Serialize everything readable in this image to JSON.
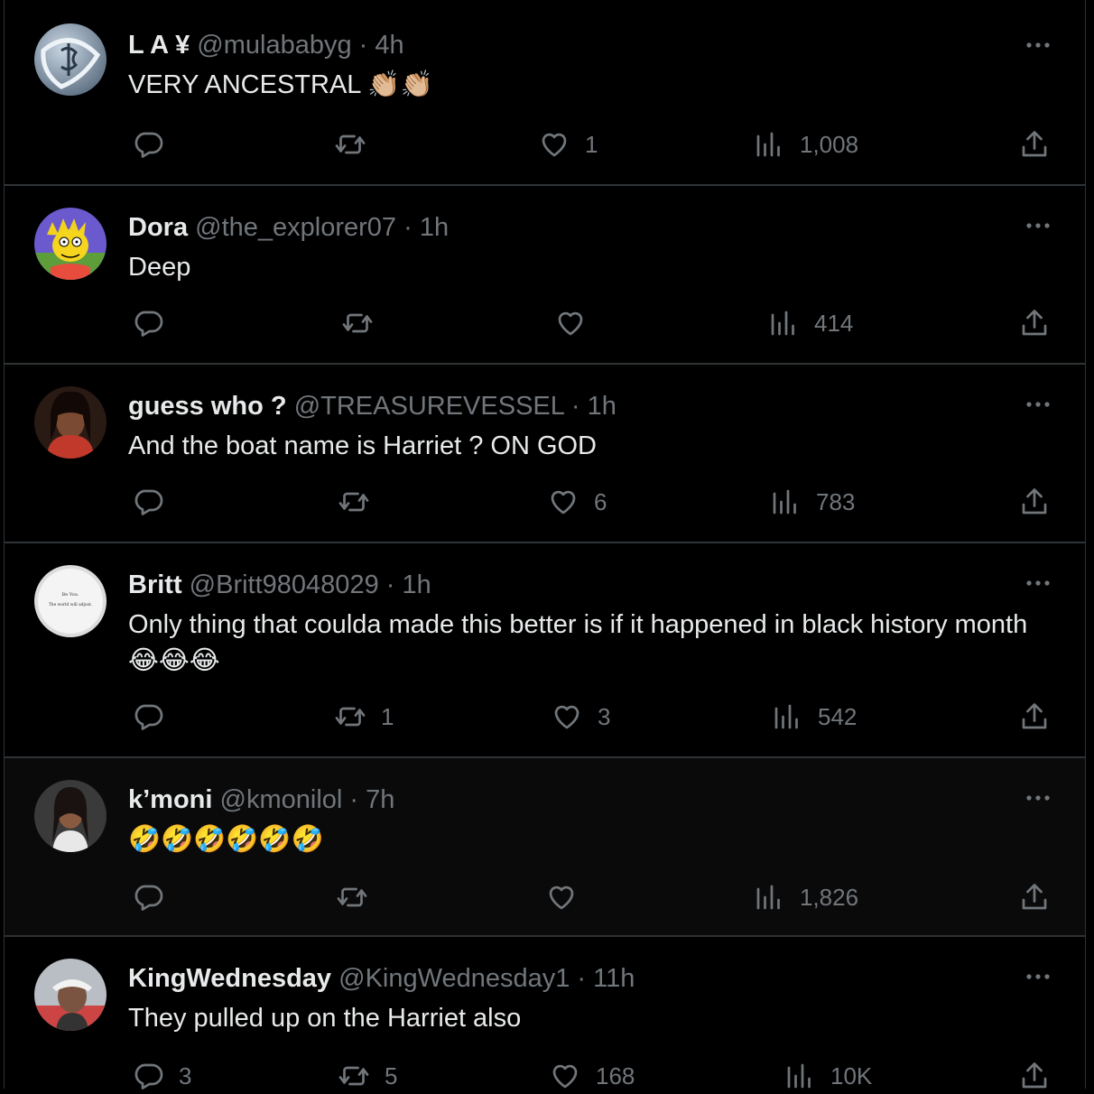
{
  "colors": {
    "background": "#000000",
    "text": "#e7e9ea",
    "secondary": "#71767b",
    "divider": "#2f3336"
  },
  "icons": {
    "reply": "reply-icon",
    "retweet": "retweet-icon",
    "like": "heart-icon",
    "views": "views-icon",
    "share": "share-icon",
    "more": "more-icon"
  },
  "tweets": [
    {
      "name": "L A ¥",
      "handle": "@mulababyg",
      "sep": "·",
      "time": "4h",
      "text": "VERY ANCESTRAL 👏🏼👏🏼",
      "replies": "",
      "retweets": "",
      "likes": "1",
      "views": "1,008"
    },
    {
      "name": "Dora",
      "handle": "@the_explorer07",
      "sep": "·",
      "time": "1h",
      "text": "Deep",
      "replies": "",
      "retweets": "",
      "likes": "",
      "views": "414"
    },
    {
      "name": "guess who ?",
      "handle": "@TREASUREVESSEL",
      "sep": "·",
      "time": "1h",
      "text": "And the boat name is Harriet ? ON GOD",
      "replies": "",
      "retweets": "",
      "likes": "6",
      "views": "783"
    },
    {
      "name": "Britt",
      "handle": "@Britt98048029",
      "sep": "·",
      "time": "1h",
      "text": "Only thing that coulda made this better is if it happened in black history month😂😂😂",
      "replies": "",
      "retweets": "1",
      "likes": "3",
      "views": "542",
      "avatar_text": [
        "Be You.",
        "The world will adjust."
      ]
    },
    {
      "name": "k’moni",
      "handle": "@kmonilol",
      "sep": "·",
      "time": "7h",
      "text": "🤣🤣🤣🤣🤣🤣",
      "replies": "",
      "retweets": "",
      "likes": "",
      "views": "1,826"
    },
    {
      "name": "KingWednesday",
      "handle": "@KingWednesday1",
      "sep": "·",
      "time": "11h",
      "text": "They pulled up on the Harriet also",
      "replies": "3",
      "retweets": "5",
      "likes": "168",
      "views": "10K"
    }
  ]
}
